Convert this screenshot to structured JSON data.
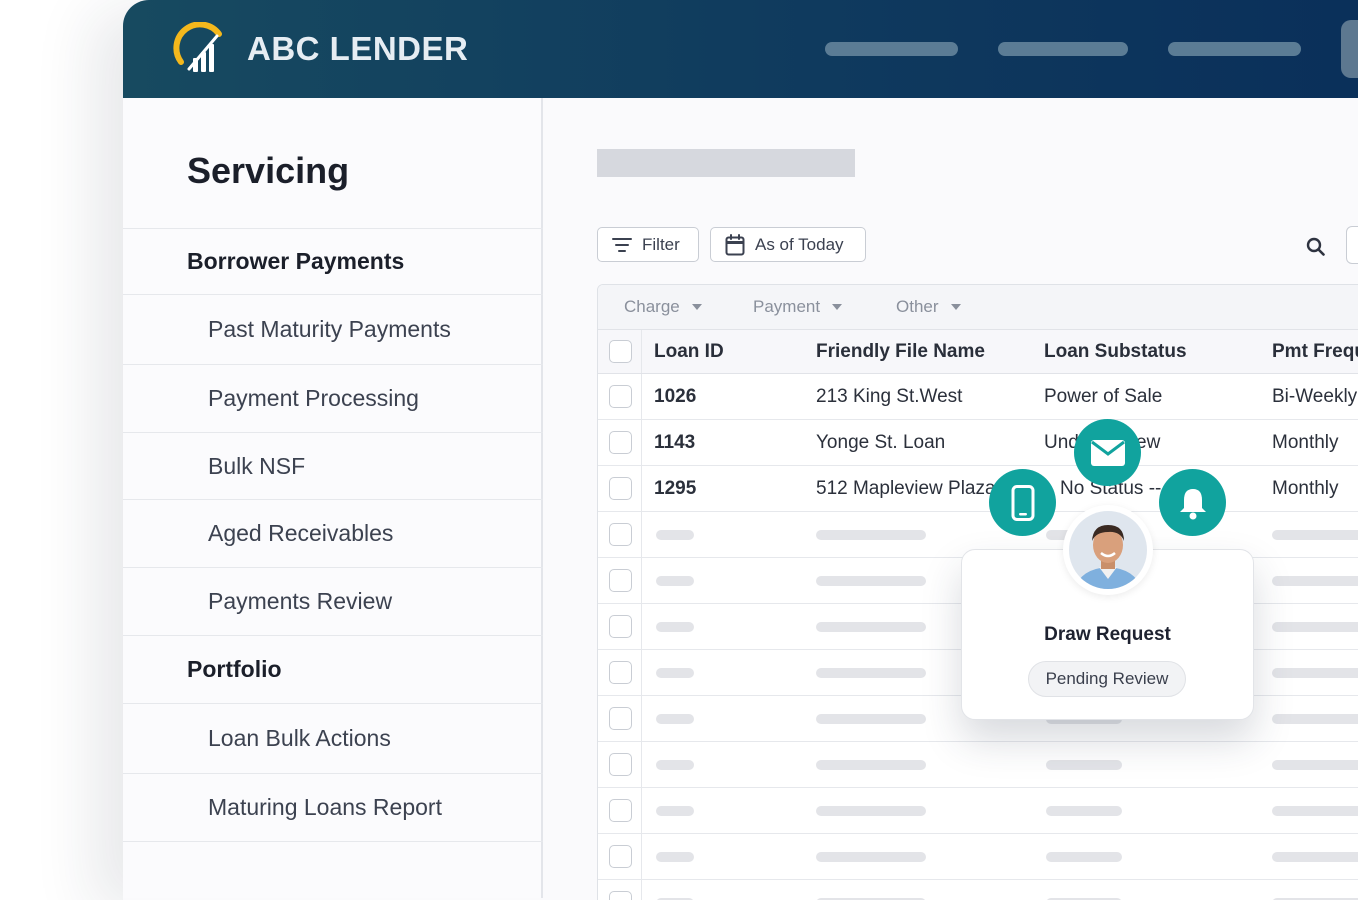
{
  "app": {
    "brand": "ABC LENDER",
    "brand_color": "#0f3a5e",
    "accent_color": "#11a39e",
    "logo_icon": "gauge-logo-icon"
  },
  "sidebar": {
    "title": "Servicing",
    "items": [
      {
        "label": "Borrower Payments",
        "kind": "section"
      },
      {
        "label": "Past Maturity Payments",
        "kind": "sub"
      },
      {
        "label": "Payment Processing",
        "kind": "sub"
      },
      {
        "label": "Bulk NSF",
        "kind": "sub"
      },
      {
        "label": "Aged Receivables",
        "kind": "sub"
      },
      {
        "label": "Payments Review",
        "kind": "sub"
      },
      {
        "label": "Portfolio",
        "kind": "section"
      },
      {
        "label": "Loan Bulk Actions",
        "kind": "sub"
      },
      {
        "label": "Maturing Loans Report",
        "kind": "sub"
      }
    ]
  },
  "toolbar": {
    "filter_label": "Filter",
    "filter_icon": "filter-icon",
    "date_label": "As of Today",
    "date_icon": "calendar-icon",
    "search_icon": "search-icon"
  },
  "filters": [
    "Charge",
    "Payment",
    "Other"
  ],
  "table": {
    "columns": [
      "Loan ID",
      "Friendly File Name",
      "Loan Substatus",
      "Pmt Frequ"
    ],
    "rows": [
      {
        "id": "1026",
        "name": "213 King St.West",
        "substatus": "Power of Sale",
        "freq": "Bi-Weekly"
      },
      {
        "id": "1143",
        "name": "Yonge St. Loan",
        "substatus": "Und",
        "substatus_tail": "ew",
        "freq": "Monthly"
      },
      {
        "id": "1295",
        "name": "512 Mapleview Plaza",
        "substatus": "No Status --",
        "substatus_prefix": "-",
        "freq": "Monthly"
      }
    ]
  },
  "notification_card": {
    "title": "Draw Request",
    "status": "Pending Review",
    "icons": [
      "mobile-phone-icon",
      "email-icon",
      "bell-icon"
    ]
  }
}
